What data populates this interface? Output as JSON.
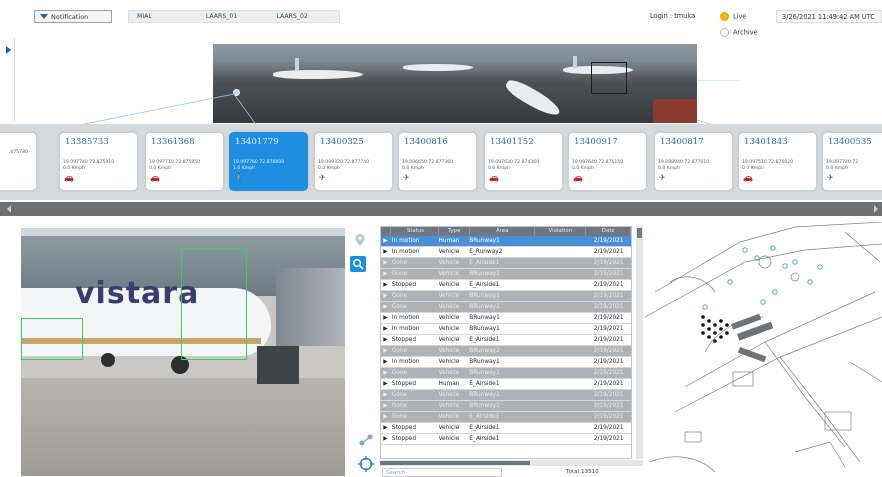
{
  "topbar": {
    "notification_label": "Notification",
    "context_tabs": [
      "MIAL",
      "LAARS_01",
      "LAARS_02"
    ],
    "login_text": "Login : tmuka",
    "mode_options": [
      {
        "label": "Live",
        "selected": true
      },
      {
        "label": "Archive",
        "selected": false
      }
    ],
    "datetime": "3/26/2021 11:49:42 AM UTC"
  },
  "colors": {
    "accent": "#1f8ee0",
    "live_radio": "#f2b600",
    "table_selected": "#4a8fd6",
    "detection_box": "#31d35b"
  },
  "track_cards": [
    {
      "id": "",
      "coord": ".075780",
      "speed": "",
      "icon": "",
      "partial_left": true
    },
    {
      "id": "13385733",
      "coord": "19.097740 72.875910",
      "speed": "0.0 Kmph",
      "icon": "vehicle-icon"
    },
    {
      "id": "13361368",
      "coord": "19.097710 72.875950",
      "speed": "0.0 Kmph",
      "icon": "vehicle-icon"
    },
    {
      "id": "13401779",
      "coord": "19.097760 72.876000",
      "speed": "1.0 Kmph",
      "icon": "human-icon",
      "selected": true
    },
    {
      "id": "13400325",
      "coord": "19.099320 72.877740",
      "speed": "0.0 Kmph",
      "icon": "aircraft-icon"
    },
    {
      "id": "13400816",
      "coord": "19.096650 72.877360",
      "speed": "0.0 Kmph",
      "icon": "aircraft-icon"
    },
    {
      "id": "13401152",
      "coord": "19.097630 72.874360",
      "speed": "0.0 Kmph",
      "icon": "vehicle-icon"
    },
    {
      "id": "13400917",
      "coord": "19.097640 72.876150",
      "speed": "0.0 Kmph",
      "icon": "vehicle-icon"
    },
    {
      "id": "13400817",
      "coord": "19.098940 72.877010",
      "speed": "0.0 Kmph",
      "icon": "aircraft-icon"
    },
    {
      "id": "13401843",
      "coord": "19.097510 72.876020",
      "speed": "0.0 Kmph",
      "icon": "vehicle-icon"
    },
    {
      "id": "13400535",
      "coord": "19.097740 72.",
      "speed": "0.0 Kmph",
      "icon": "aircraft-icon"
    }
  ],
  "table": {
    "headers": [
      "Status",
      "Type",
      "Area",
      "Violation",
      "Date"
    ],
    "rows": [
      {
        "status": "In motion",
        "type": "Human",
        "area": "BRunway1",
        "violation": "",
        "date": "2/19/2021",
        "style": "sel"
      },
      {
        "status": "In motion",
        "type": "Vehicle",
        "area": "E_Runway2",
        "violation": "",
        "date": "2/19/2021",
        "style": "white"
      },
      {
        "status": "Gone",
        "type": "Vehicle",
        "area": "E_Airside1",
        "violation": "",
        "date": "2/19/2021",
        "style": "gray"
      },
      {
        "status": "Gone",
        "type": "Vehicle",
        "area": "BRunway1",
        "violation": "",
        "date": "2/19/2021",
        "style": "gray"
      },
      {
        "status": "Stopped",
        "type": "Vehicle",
        "area": "E_Airside1",
        "violation": "",
        "date": "2/19/2021",
        "style": "white"
      },
      {
        "status": "Gone",
        "type": "Vehicle",
        "area": "BRunway1",
        "violation": "",
        "date": "2/19/2021",
        "style": "gray"
      },
      {
        "status": "Gone",
        "type": "Vehicle",
        "area": "BRunway1",
        "violation": "",
        "date": "2/19/2021",
        "style": "gray"
      },
      {
        "status": "In motion",
        "type": "Vehicle",
        "area": "BRunway1",
        "violation": "",
        "date": "2/19/2021",
        "style": "white"
      },
      {
        "status": "In motion",
        "type": "Vehicle",
        "area": "BRunway1",
        "violation": "",
        "date": "2/19/2021",
        "style": "white"
      },
      {
        "status": "Stopped",
        "type": "Vehicle",
        "area": "E_Airside1",
        "violation": "",
        "date": "2/19/2021",
        "style": "white"
      },
      {
        "status": "Gone",
        "type": "Vehicle",
        "area": "BRunway2",
        "violation": "",
        "date": "2/19/2021",
        "style": "gray"
      },
      {
        "status": "In motion",
        "type": "Vehicle",
        "area": "BRunway1",
        "violation": "",
        "date": "2/19/2021",
        "style": "white"
      },
      {
        "status": "Gone",
        "type": "Vehicle",
        "area": "BRunway1",
        "violation": "",
        "date": "2/19/2021",
        "style": "gray"
      },
      {
        "status": "Stopped",
        "type": "Human",
        "area": "E_Airside1",
        "violation": "",
        "date": "2/19/2021",
        "style": "white"
      },
      {
        "status": "Gone",
        "type": "Vehicle",
        "area": "BRunway1",
        "violation": "",
        "date": "2/19/2021",
        "style": "gray"
      },
      {
        "status": "Gone",
        "type": "Vehicle",
        "area": "BRunway1",
        "violation": "",
        "date": "2/19/2021",
        "style": "gray"
      },
      {
        "status": "Gone",
        "type": "Vehicle",
        "area": "E_Airside1",
        "violation": "",
        "date": "2/19/2021",
        "style": "gray"
      },
      {
        "status": "Stopped",
        "type": "Vehicle",
        "area": "E_Airside1",
        "violation": "",
        "date": "2/19/2021",
        "style": "white"
      },
      {
        "status": "Stopped",
        "type": "Vehicle",
        "area": "E_Airside1",
        "violation": "",
        "date": "2/19/2021",
        "style": "white"
      }
    ],
    "search_placeholder": "Search",
    "total_label": "Total:13510"
  },
  "cctv": {
    "logo_text": "vistara"
  },
  "tools": [
    "location-pin-icon",
    "search-icon",
    "share-icon",
    "crosshair-icon"
  ]
}
